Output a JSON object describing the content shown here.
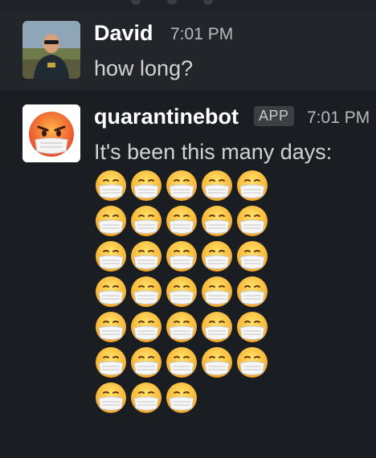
{
  "messages": [
    {
      "author": "David",
      "time": "7:01 PM",
      "text": "how long?",
      "avatar": "photo-avatar"
    },
    {
      "author": "quarantinebot",
      "badge": "APP",
      "time": "7:01 PM",
      "text": "It's been this many days:",
      "avatar": "angry-mask-face-avatar",
      "emoji_name": "face-with-medical-mask",
      "emoji_count": 33
    }
  ],
  "colors": {
    "background": "#1a1d21",
    "highlight_row": "#222529",
    "name": "#ffffff",
    "text": "#d1d2d3"
  }
}
